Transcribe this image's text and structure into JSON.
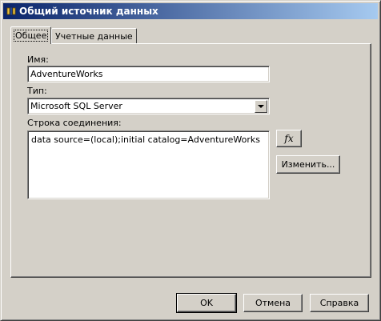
{
  "window": {
    "title": "Общий источник данных"
  },
  "tabs": [
    {
      "label": "Общее",
      "active": true
    },
    {
      "label": "Учетные данные",
      "active": false
    }
  ],
  "form": {
    "name_label": "Имя:",
    "name_value": "AdventureWorks",
    "type_label": "Тип:",
    "type_value": "Microsoft SQL Server",
    "conn_label": "Строка соединения:",
    "conn_value": "data source=(local);initial catalog=AdventureWorks",
    "expr_button_glyph": "fx",
    "edit_button_label": "Изменить..."
  },
  "footer": {
    "ok_label": "OK",
    "cancel_label": "Отмена",
    "help_label": "Справка"
  },
  "icons": {
    "app": "data-source-icon",
    "dropdown": "chevron-down-icon",
    "expression": "function-icon"
  }
}
